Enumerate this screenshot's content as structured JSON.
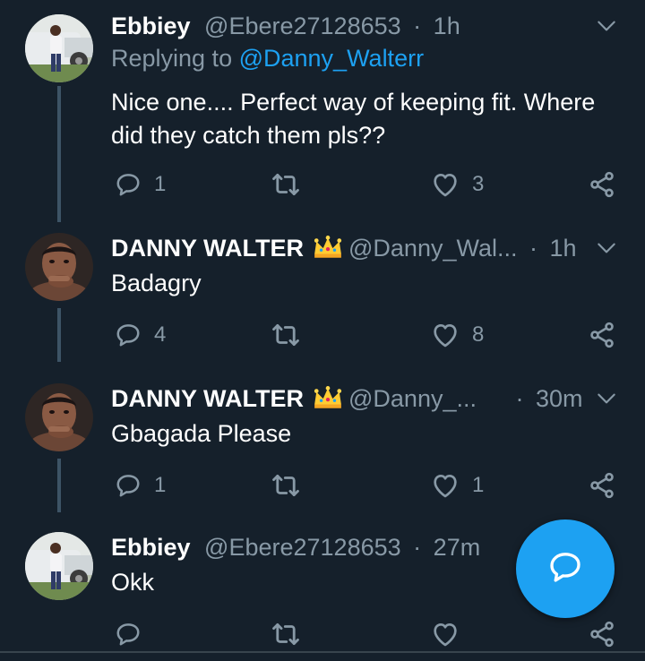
{
  "tweets": [
    {
      "name": "Ebbiey",
      "handle": "@Ebere27128653",
      "separator": "·",
      "time": "1h",
      "replying_prefix": "Replying to ",
      "replying_mention": "@Danny_Walterr",
      "text": "Nice one.... Perfect way of keeping fit. Where did they catch them pls??",
      "replies": "1",
      "likes": "3"
    },
    {
      "name": "DANNY WALTER",
      "handle": "@Danny_Wal...",
      "separator": "·",
      "time": "1h",
      "text": "Badagry",
      "replies": "4",
      "likes": "8"
    },
    {
      "name": "DANNY WALTER",
      "handle": "@Danny_...",
      "separator": "·",
      "time": "30m",
      "text": "Gbagada Please",
      "replies": "1",
      "likes": "1"
    },
    {
      "name": "Ebbiey",
      "handle": "@Ebere27128653",
      "separator": "·",
      "time": "27m",
      "text": "Okk",
      "replies": "",
      "likes": ""
    }
  ],
  "icons": {
    "crown": "crown-emoji-icon",
    "reply": "reply-icon",
    "retweet": "retweet-icon",
    "like": "heart-icon",
    "share": "share-icon",
    "more": "chevron-down-icon",
    "compose": "compose-reply-icon"
  },
  "colors": {
    "background": "#15202b",
    "text": "#ffffff",
    "secondary": "#8899a6",
    "accent": "#1da1f2",
    "thread_line": "#3d5466"
  }
}
